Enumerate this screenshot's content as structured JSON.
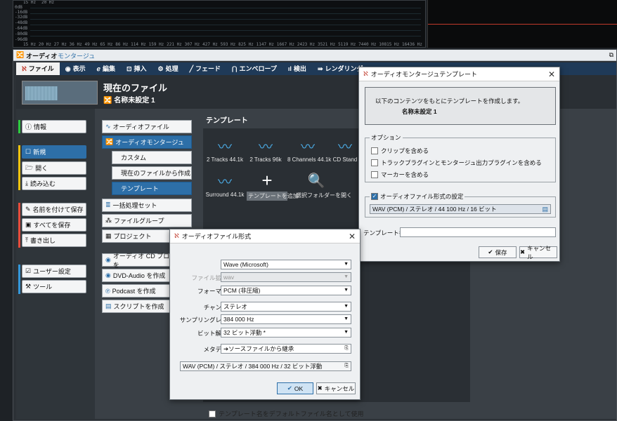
{
  "spectrum": {
    "db_labels": [
      "0dB",
      "-16dB",
      "-32dB",
      "-48dB",
      "-64dB",
      "-80dB",
      "-96dB"
    ],
    "freq_labels": [
      "15 Hz",
      "20 Hz",
      "27 Hz",
      "36 Hz",
      "49 Hz",
      "65 Hz",
      "86 Hz",
      "114 Hz",
      "159 Hz",
      "221 Hz",
      "307 Hz",
      "427 Hz",
      "593 Hz",
      "825 Hz",
      "1147 Hz",
      "1667 Hz",
      "2423 Hz",
      "3521 Hz",
      "5119 Hz",
      "7440 Hz",
      "10815 Hz",
      "16436 Hz"
    ]
  },
  "window": {
    "title_a": "オーディオ",
    "title_b": "モンタージュ"
  },
  "tabs": [
    {
      "label": "ファイル",
      "icon": "wavelab-logo-icon"
    },
    {
      "label": "表示",
      "icon": "eye-icon"
    },
    {
      "label": "編集",
      "icon": "edit-icon"
    },
    {
      "label": "挿入",
      "icon": "insert-icon"
    },
    {
      "label": "処理",
      "icon": "process-icon"
    },
    {
      "label": "フェード",
      "icon": "fade-icon"
    },
    {
      "label": "エンベロープ",
      "icon": "envelope-icon"
    },
    {
      "label": "検出",
      "icon": "analysis-icon"
    },
    {
      "label": "レンダリング",
      "icon": "render-icon"
    }
  ],
  "header": {
    "title": "現在のファイル",
    "subtitle": "名称未設定 1"
  },
  "left_nav": [
    "情報",
    "新規",
    "開く",
    "読み込む",
    "名前を付けて保存",
    "すべてを保存",
    "書き出し",
    "ユーザー設定",
    "ツール"
  ],
  "mid_nav": {
    "audio_file": "オーディオファイル",
    "audio_montage": "オーディオモンタージュ",
    "custom": "カスタム",
    "from_current": "現在のファイルから作成",
    "template": "テンプレート",
    "batch_set": "一括処理セット",
    "file_group": "ファイルグループ",
    "project": "プロジェクト",
    "audio_cd": "オーディオ CD プログラムを",
    "dvd_audio": "DVD-Audio を作成",
    "podcast": "Podcast を作成",
    "script": "スクリプトを作成"
  },
  "templates": {
    "title": "テンプレート",
    "items": [
      "2 Tracks 44.1k",
      "2 Tracks 96k",
      "8 Channels 44.1k",
      "CD Stand",
      "Surround 44.1k",
      "テンプレートを追加",
      "選択フォルダーを開く"
    ],
    "use_name_label": "テンプレート名をデフォルトファイル名として使用"
  },
  "template_dialog": {
    "title": "オーディオモンタージュテンプレート",
    "info_line1": "以下のコンテンツをもとにテンプレートを作成します。",
    "info_line2": "名称未設定 1",
    "options_label": "オプション",
    "opt1": "クリップを含める",
    "opt2": "トラックプラグインとモンタージュ出力プラグインを含める",
    "opt3": "マーカーを含める",
    "audio_format_label": "オーディオファイル形式の設定",
    "audio_format_value": "WAV (PCM) / ステレオ / 44 100 Hz / 16 ビット",
    "template_name_label": "テンプレート名",
    "template_name_value": "",
    "save": "保存",
    "cancel": "キャンセル"
  },
  "format_dialog": {
    "title": "オーディオファイル形式",
    "type_label": "種類",
    "type_value": "Wave (Microsoft)",
    "ext_label": "ファイル拡張子",
    "ext_value": "wav",
    "format_label": "フォーマット",
    "format_value": "PCM (非圧縮)",
    "channel_label": "チャンネル",
    "channel_value": "ステレオ",
    "rate_label": "サンプリングレート",
    "rate_value": "384 000 Hz",
    "bits_label": "ビット解像度",
    "bits_value": "32 ビット浮動 *",
    "meta_label": "メタデータ",
    "meta_value": "ソースファイルから継承",
    "summary": "WAV (PCM) / ステレオ / 384 000 Hz / 32 ビット浮動",
    "ok": "OK",
    "cancel": "キャンセル"
  }
}
